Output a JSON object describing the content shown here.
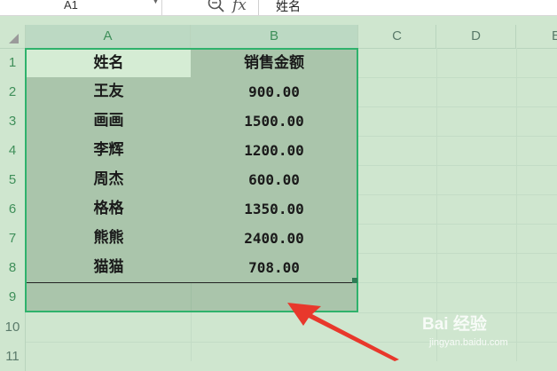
{
  "name_box": {
    "value": "A1"
  },
  "formula_bar": {
    "fx_label": "fx",
    "content": "姓名"
  },
  "columns": [
    "A",
    "B",
    "C",
    "D",
    "E"
  ],
  "rows": [
    "1",
    "2",
    "3",
    "4",
    "5",
    "6",
    "7",
    "8",
    "9",
    "10",
    "11"
  ],
  "table": {
    "headers": [
      "姓名",
      "销售金额"
    ],
    "records": [
      [
        "王友",
        "900.00"
      ],
      [
        "画画",
        "1500.00"
      ],
      [
        "李辉",
        "1200.00"
      ],
      [
        "周杰",
        "600.00"
      ],
      [
        "格格",
        "1350.00"
      ],
      [
        "熊熊",
        "2400.00"
      ],
      [
        "猫猫",
        "708.00"
      ]
    ]
  },
  "watermark": {
    "brand": "Bai 经验",
    "url": "jingyan.baidu.com"
  },
  "colors": {
    "selection_border": "#2fb26c",
    "selected_fill": "#aac5ab",
    "sheet_bg": "#cfe6cf",
    "arrow": "#e8382c"
  }
}
